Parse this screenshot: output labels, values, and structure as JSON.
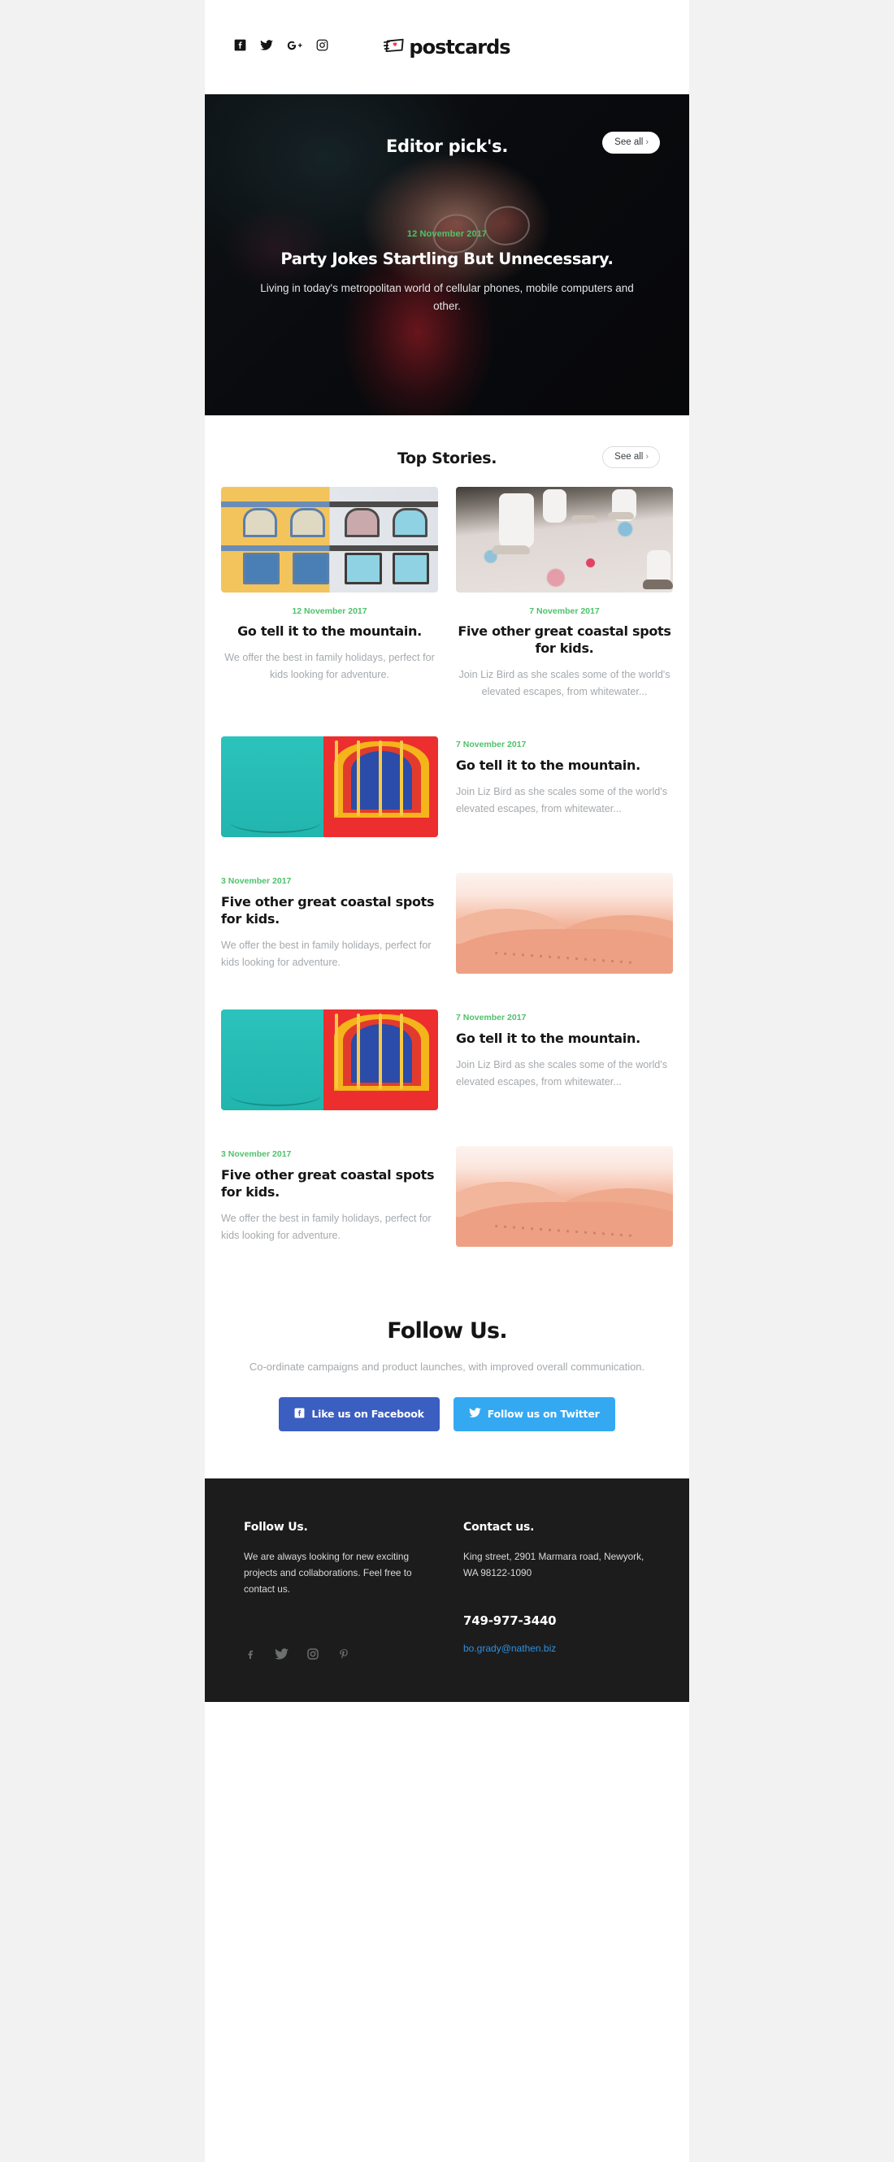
{
  "header": {
    "brand_name": "postcards",
    "brand_icon": "postcard-heart-logo-icon",
    "social": [
      {
        "name": "facebook",
        "icon": "facebook-icon",
        "label": "Facebook"
      },
      {
        "name": "twitter",
        "icon": "twitter-icon",
        "label": "Twitter"
      },
      {
        "name": "googleplus",
        "icon": "google-plus-icon",
        "label": "Google Plus"
      },
      {
        "name": "instagram",
        "icon": "instagram-icon",
        "label": "Instagram"
      }
    ]
  },
  "hero": {
    "eyebrow_title": "Editor pick's.",
    "see_all_label": "See all",
    "chevron": "›",
    "date": "12 November 2017",
    "headline": "Party Jokes Startling But Unnecessary.",
    "subtext": "Living in today's metropolitan world of cellular phones, mobile computers and other.",
    "image_alt": "portrait of person wearing glasses in dark room"
  },
  "top_stories": {
    "title": "Top Stories.",
    "see_all_label": "See all",
    "chevron": "›",
    "cards": [
      {
        "date": "12 November 2017",
        "title": "Go tell it to the mountain.",
        "text": "We offer the best in family holidays, perfect for kids looking for adventure.",
        "image_alt": "yellow and grey building facade with arched windows"
      },
      {
        "date": "7 November 2017",
        "title": "Five other great coastal spots for kids.",
        "text": "Join Liz Bird as she scales some of the world's elevated escapes, from whitewater...",
        "image_alt": "people in white clothes on paint splattered ground"
      }
    ]
  },
  "rows": [
    {
      "layout": "image-left",
      "date": "7 November 2017",
      "title": "Go tell it to the mountain.",
      "text": "Join Liz Bird as she scales some of the world's elevated escapes, from whitewater...",
      "image_alt": "teal wall with red and yellow arched window"
    },
    {
      "layout": "image-right",
      "date": "3 November 2017",
      "title": "Five other great coastal spots for kids.",
      "text": "We offer the best in family holidays, perfect for kids looking for adventure.",
      "image_alt": "pink desert sand dunes"
    },
    {
      "layout": "image-left",
      "date": "7 November 2017",
      "title": "Go tell it to the mountain.",
      "text": "Join Liz Bird as she scales some of the world's elevated escapes, from whitewater...",
      "image_alt": "teal wall with red and yellow arched window"
    },
    {
      "layout": "image-right",
      "date": "3 November 2017",
      "title": "Five other great coastal spots for kids.",
      "text": "We offer the best in family holidays, perfect for kids looking for adventure.",
      "image_alt": "pink desert sand dunes"
    }
  ],
  "follow": {
    "title": "Follow Us.",
    "subtext": "Co-ordinate campaigns and product launches, with improved overall communication.",
    "facebook_button": "Like us on Facebook",
    "twitter_button": "Follow us on Twitter",
    "facebook_color": "#3b5ec1",
    "twitter_color": "#34a9f2"
  },
  "footer": {
    "col1_title": "Follow Us.",
    "col1_text": "We are always looking for new exciting projects and collaborations. Feel free to contact us.",
    "col2_title": "Contact us.",
    "address": "King street, 2901 Marmara road, Newyork, WA 98122-1090",
    "phone": "749-977-3440",
    "email": "bo.grady@nathen.biz",
    "email_color": "#2f8fe0",
    "background": "#1c1c1c",
    "social": [
      {
        "name": "facebook",
        "icon": "facebook-icon",
        "label": "Facebook"
      },
      {
        "name": "twitter",
        "icon": "twitter-icon",
        "label": "Twitter"
      },
      {
        "name": "instagram",
        "icon": "instagram-icon",
        "label": "Instagram"
      },
      {
        "name": "pinterest",
        "icon": "pinterest-icon",
        "label": "Pinterest"
      }
    ]
  },
  "theme": {
    "accent_green": "#4ec26b",
    "page_background": "#f2f2f2",
    "email_background": "#ffffff"
  }
}
